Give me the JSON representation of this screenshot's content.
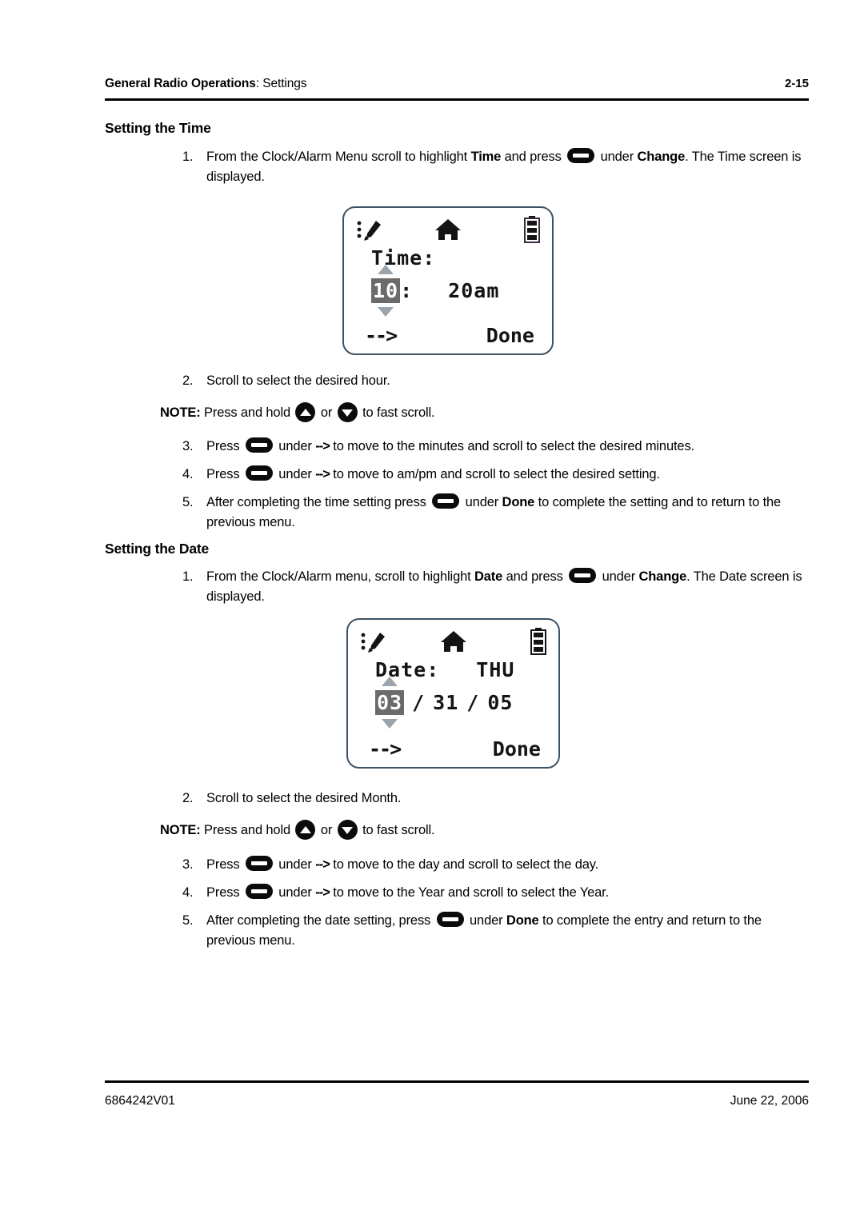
{
  "header": {
    "title_bold": "General Radio Operations",
    "title_rest": ": Settings",
    "page_number": "2-15"
  },
  "footer": {
    "doc_number": "6864242V01",
    "date": "June 22, 2006"
  },
  "sections": {
    "time": {
      "heading": "Setting the Time",
      "steps": {
        "s1_num": "1.",
        "s1_a": "From the Clock/Alarm Menu scroll to highlight ",
        "s1_b": "Time",
        "s1_c": " and press ",
        "s1_d": " under ",
        "s1_e": "Change",
        "s1_f": ". The Time screen is displayed.",
        "s2_num": "2.",
        "s2_text": "Scroll to select the desired hour.",
        "note_label": "NOTE:",
        "note_a": " Press and hold ",
        "note_b": " or ",
        "note_c": " to fast scroll.",
        "s3_num": "3.",
        "s3_a": "Press ",
        "s3_b": " under ",
        "s3_arrow": "-->",
        "s3_c": " to move to the minutes and scroll to select the desired minutes.",
        "s4_num": "4.",
        "s4_a": "Press ",
        "s4_b": " under ",
        "s4_arrow": "-->",
        "s4_c": " to move to am/pm and scroll to select the desired setting.",
        "s5_num": "5.",
        "s5_a": "After completing the time setting press ",
        "s5_b": " under ",
        "s5_c": "Done",
        "s5_d": " to complete the setting and to return to the previous menu."
      },
      "lcd": {
        "icons": [
          "wrench-icon",
          "home-icon",
          "battery-icon"
        ],
        "label": "Time:",
        "hour_selected": "10",
        "colon": ":",
        "minutes_ampm": "20am",
        "left_softkey": "-->",
        "right_softkey": "Done"
      }
    },
    "date": {
      "heading": "Setting the Date",
      "steps": {
        "s1_num": "1.",
        "s1_a": "From the Clock/Alarm menu, scroll to highlight ",
        "s1_b": "Date",
        "s1_c": " and press ",
        "s1_d": " under ",
        "s1_e": "Change",
        "s1_f": ". The Date screen is displayed.",
        "s2_num": "2.",
        "s2_text": "Scroll to select the desired Month.",
        "note_label": "NOTE:",
        "note_a": " Press and hold ",
        "note_b": " or ",
        "note_c": " to fast scroll.",
        "s3_num": "3.",
        "s3_a": "Press ",
        "s3_b": " under ",
        "s3_arrow": "-->",
        "s3_c": " to move to the day and scroll to select the day.",
        "s4_num": "4.",
        "s4_a": "Press ",
        "s4_b": " under ",
        "s4_arrow": "-->",
        "s4_c": " to move to the Year and scroll to select the Year.",
        "s5_num": "5.",
        "s5_a": "After completing the date setting, press ",
        "s5_b": " under ",
        "s5_c": "Done",
        "s5_d": " to complete the entry and return to the previous menu."
      },
      "lcd": {
        "icons": [
          "wrench-icon",
          "home-icon",
          "battery-icon"
        ],
        "label": "Date:",
        "weekday": "THU",
        "month_selected": "03",
        "sep1": "/",
        "day": "31",
        "sep2": "/",
        "year": "05",
        "left_softkey": "-->",
        "right_softkey": "Done"
      }
    }
  },
  "colors": {
    "text": "#000000",
    "lcd_border": "#3d5264",
    "lcd_highlight_bg": "#6b6b6b",
    "caret": "#9aa4ac"
  }
}
